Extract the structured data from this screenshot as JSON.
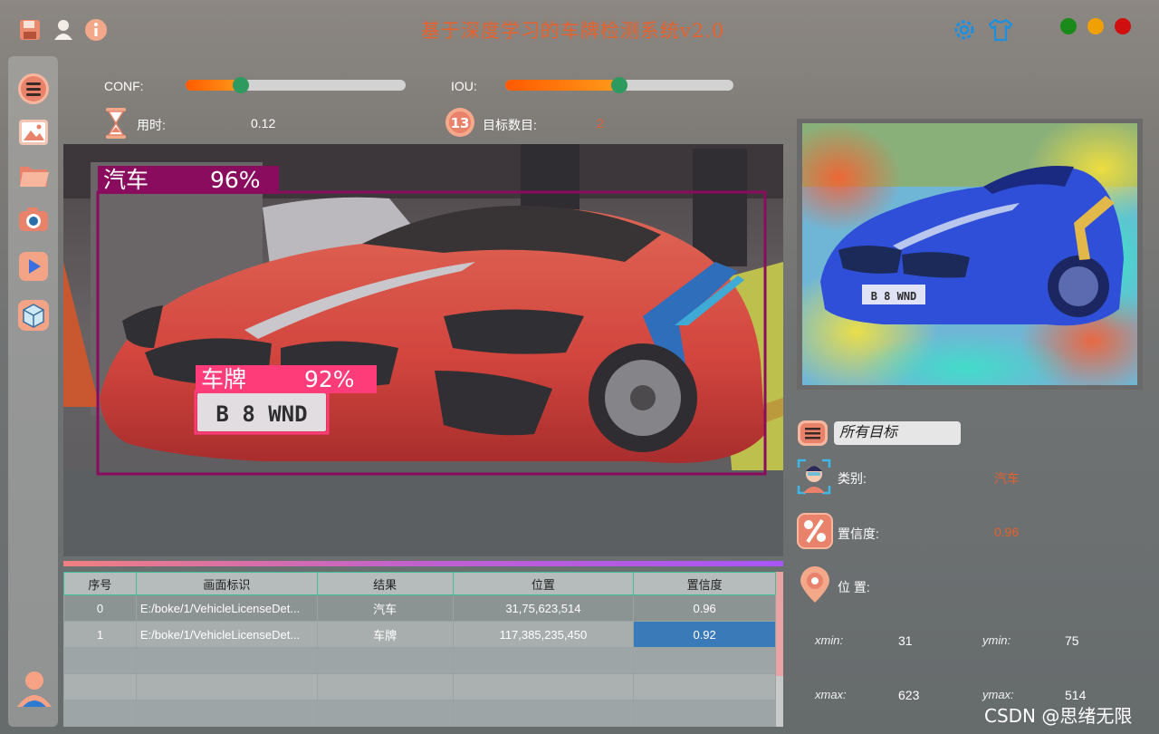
{
  "app": {
    "title": "基于深度学习的车牌检测系统v2.0"
  },
  "topbar": {
    "icons": [
      "save-icon",
      "user-icon",
      "info-icon"
    ],
    "right_icons": [
      "settings-gear-icon",
      "tshirt-skin-icon"
    ],
    "window_buttons": {
      "minimize": "#1a8a1a",
      "maximize": "#f0a000",
      "close": "#d01010"
    }
  },
  "sidebar": {
    "items": [
      "menu-icon",
      "image-icon",
      "folder-icon",
      "camera-icon",
      "video-play-icon",
      "model-cube-icon"
    ],
    "bottom": "user-avatar-icon"
  },
  "controls": {
    "conf": {
      "label": "CONF:",
      "value": 0.25
    },
    "iou": {
      "label": "IOU:",
      "value": 0.5
    },
    "time_label": "用时:",
    "time_value": "0.12",
    "count_label": "目标数目:",
    "count_value": "2"
  },
  "detections_overlay": [
    {
      "label": "汽车",
      "score": "96%"
    },
    {
      "label": "车牌",
      "score": "92%"
    }
  ],
  "plate_text": "B 8 WND",
  "table": {
    "headers": [
      "序号",
      "画面标识",
      "结果",
      "位置",
      "置信度"
    ],
    "rows": [
      [
        "0",
        "E:/boke/1/VehicleLicenseDet...",
        "汽车",
        "31,75,623,514",
        "0.96"
      ],
      [
        "1",
        "E:/boke/1/VehicleLicenseDet...",
        "车牌",
        "117,385,235,450",
        "0.92"
      ]
    ]
  },
  "right_panel": {
    "target_select": "所有目标",
    "class_label": "类别:",
    "class_value": "汽车",
    "conf_label": "置信度:",
    "conf_value": "0.96",
    "pos_label": "位 置:",
    "xmin_label": "xmin:",
    "xmin": "31",
    "ymin_label": "ymin:",
    "ymin": "75",
    "xmax_label": "xmax:",
    "xmax": "623",
    "ymax_label": "ymax:",
    "ymax": "514"
  },
  "watermark": "CSDN @思绪无限",
  "colors": {
    "accent": "#e8602a",
    "box_car": "#8a0c5e",
    "box_plate": "#ff3c7a",
    "slider_knob": "#2e9a5e"
  }
}
